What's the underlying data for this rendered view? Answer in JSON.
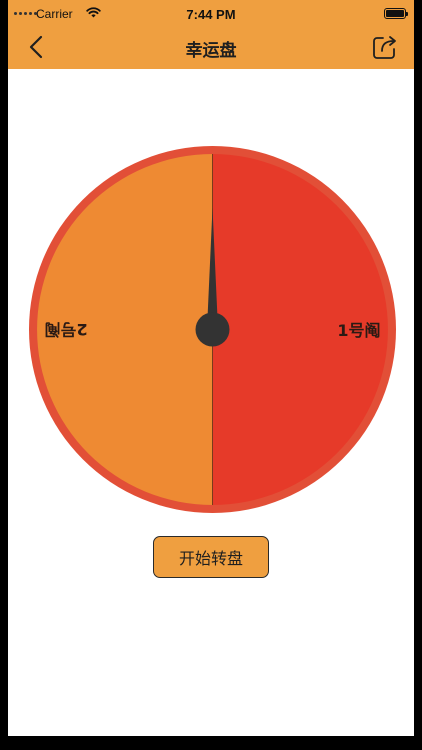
{
  "status_bar": {
    "carrier": "Carrier",
    "time": "7:44 PM",
    "icons": [
      "signal-dots-icon",
      "wifi-icon",
      "battery-icon"
    ]
  },
  "nav": {
    "title": "幸运盘",
    "back_icon": "chevron-left-icon",
    "share_icon": "share-icon"
  },
  "wheel": {
    "segments": [
      {
        "label": "1号阄",
        "color": "#e63a29"
      },
      {
        "label": "2号阄",
        "color": "#ee8a33"
      }
    ],
    "rim_color": "#e24f37",
    "pointer_color": "#333333"
  },
  "start_button": {
    "label": "开始转盘"
  },
  "colors": {
    "header": "#ef9f40",
    "background": "#ffffff"
  }
}
